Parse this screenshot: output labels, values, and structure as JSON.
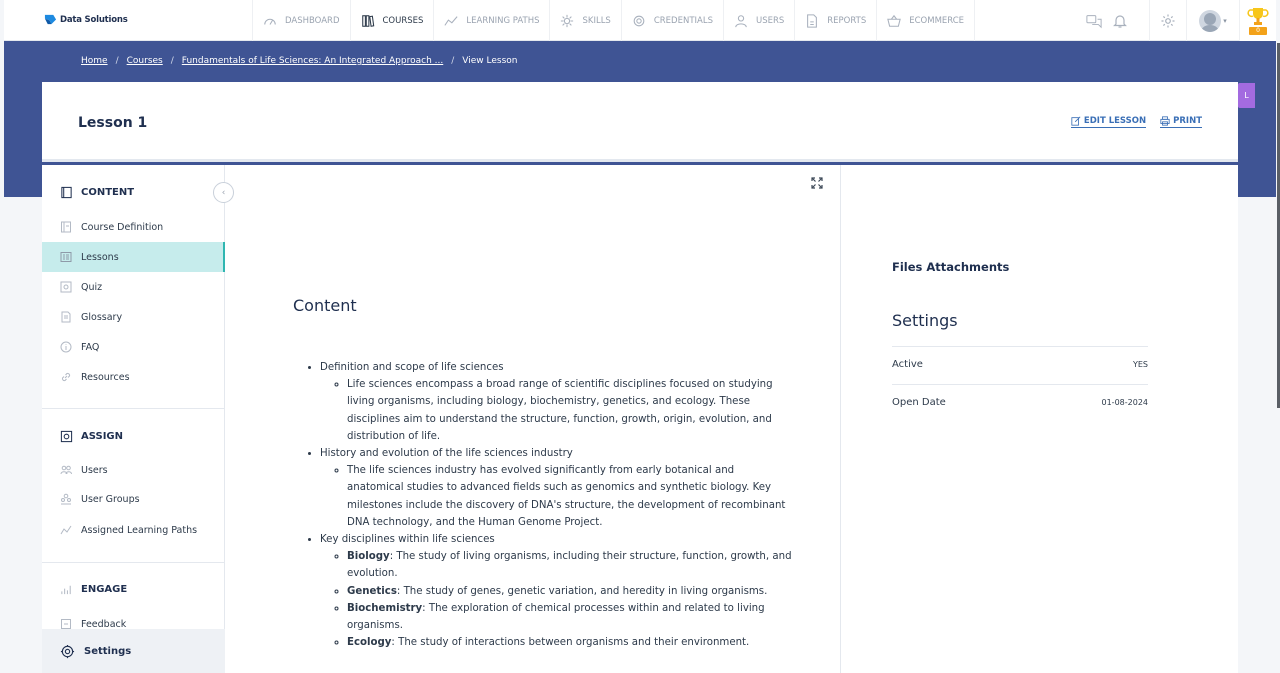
{
  "brand": {
    "name": "Data Solutions"
  },
  "nav": {
    "items": [
      {
        "label": "DASHBOARD",
        "icon": "gauge-icon",
        "active": false
      },
      {
        "label": "COURSES",
        "icon": "books-icon",
        "active": true
      },
      {
        "label": "LEARNING PATHS",
        "icon": "path-icon",
        "active": false
      },
      {
        "label": "SKILLS",
        "icon": "skills-icon",
        "active": false
      },
      {
        "label": "CREDENTIALS",
        "icon": "badge-icon",
        "active": false
      },
      {
        "label": "USERS",
        "icon": "user-icon",
        "active": false
      },
      {
        "label": "REPORTS",
        "icon": "report-icon",
        "active": false
      },
      {
        "label": "ECOMMERCE",
        "icon": "basket-icon",
        "active": false
      }
    ]
  },
  "trophy": {
    "count": "0"
  },
  "breadcrumb": {
    "home": "Home",
    "courses": "Courses",
    "course": "Fundamentals of Life Sciences: An Integrated Approach ...",
    "current": "View Lesson"
  },
  "side_tab": {
    "label": "L"
  },
  "lesson": {
    "title": "Lesson 1",
    "edit_label": "EDIT LESSON",
    "print_label": "PRINT"
  },
  "sidebar": {
    "content_heading": "CONTENT",
    "content_items": [
      "Course Definition",
      "Lessons",
      "Quiz",
      "Glossary",
      "FAQ",
      "Resources"
    ],
    "assign_heading": "ASSIGN",
    "assign_items": [
      "Users",
      "User Groups",
      "Assigned Learning Paths"
    ],
    "engage_heading": "ENGAGE",
    "engage_items": [
      "Feedback"
    ],
    "settings_label": "Settings"
  },
  "content": {
    "title": "Content",
    "topics": [
      {
        "heading": "Definition and scope of life sciences",
        "detail": "Life sciences encompass a broad range of scientific disciplines focused on studying living organisms, including biology, biochemistry, genetics, and ecology. These disciplines aim to understand the structure, function, growth, origin, evolution, and distribution of life."
      },
      {
        "heading": "History and evolution of the life sciences industry",
        "detail": "The life sciences industry has evolved significantly from early botanical and anatomical studies to advanced fields such as genomics and synthetic biology. Key milestones include the discovery of DNA's structure, the development of recombinant DNA technology, and the Human Genome Project."
      },
      {
        "heading": "Key disciplines within life sciences",
        "terms": [
          {
            "term": "Biology",
            "text": ": The study of living organisms, including their structure, function, growth, and evolution."
          },
          {
            "term": "Genetics",
            "text": ": The study of genes, genetic variation, and heredity in living organisms."
          },
          {
            "term": "Biochemistry",
            "text": ": The exploration of chemical processes within and related to living organisms."
          },
          {
            "term": "Ecology",
            "text": ": The study of interactions between organisms and their environment."
          }
        ]
      }
    ]
  },
  "files": {
    "title": "Files Attachments"
  },
  "settings_panel": {
    "title": "Settings",
    "rows": [
      {
        "label": "Active",
        "value": "YES"
      },
      {
        "label": "Open Date",
        "value": "01-08-2024"
      }
    ]
  },
  "colors": {
    "band": "#3f5494",
    "accent": "#2fb6b1",
    "active_bg": "#c6ecec",
    "link": "#3a6fb6"
  }
}
